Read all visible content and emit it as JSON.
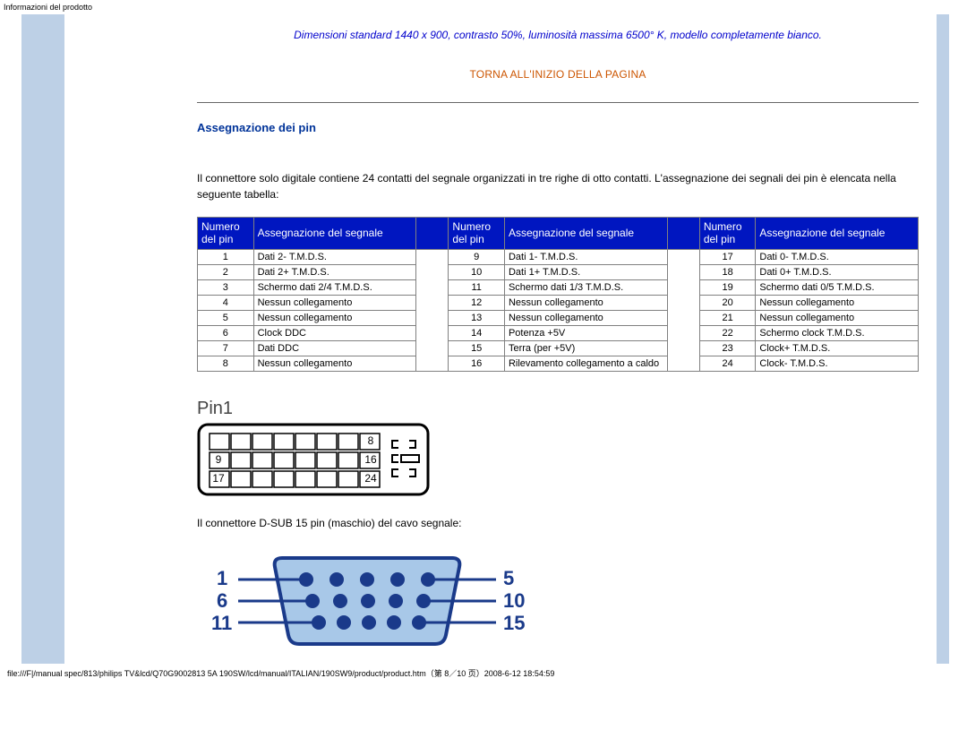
{
  "header": {
    "title": "Informazioni del prodotto"
  },
  "note": "Dimensioni standard 1440 x 900, contrasto 50%, luminosità massima 6500° K, modello completamente bianco.",
  "top_link": "TORNA ALL'INIZIO DELLA PAGINA",
  "section_title": "Assegnazione dei pin",
  "intro": "Il connettore solo digitale contiene 24 contatti del segnale organizzati in tre righe di otto contatti. L'assegnazione dei segnali dei pin è elencata nella seguente tabella:",
  "headers": {
    "num": "Numero del pin",
    "sig": "Assegnazione del segnale"
  },
  "rows": [
    {
      "n1": "1",
      "s1": "Dati 2- T.M.D.S.",
      "n2": "9",
      "s2": "Dati 1- T.M.D.S.",
      "n3": "17",
      "s3": "Dati 0- T.M.D.S."
    },
    {
      "n1": "2",
      "s1": "Dati 2+ T.M.D.S.",
      "n2": "10",
      "s2": "Dati 1+ T.M.D.S.",
      "n3": "18",
      "s3": "Dati 0+ T.M.D.S."
    },
    {
      "n1": "3",
      "s1": "Schermo dati 2/4 T.M.D.S.",
      "n2": "11",
      "s2": "Schermo dati 1/3 T.M.D.S.",
      "n3": "19",
      "s3": "Schermo dati 0/5 T.M.D.S."
    },
    {
      "n1": "4",
      "s1": "Nessun collegamento",
      "n2": "12",
      "s2": "Nessun collegamento",
      "n3": "20",
      "s3": "Nessun collegamento"
    },
    {
      "n1": "5",
      "s1": "Nessun collegamento",
      "n2": "13",
      "s2": "Nessun collegamento",
      "n3": "21",
      "s3": "Nessun collegamento"
    },
    {
      "n1": "6",
      "s1": "Clock DDC",
      "n2": "14",
      "s2": "Potenza +5V",
      "n3": "22",
      "s3": "Schermo clock T.M.D.S."
    },
    {
      "n1": "7",
      "s1": "Dati DDC",
      "n2": "15",
      "s2": "Terra (per +5V)",
      "n3": "23",
      "s3": "Clock+ T.M.D.S."
    },
    {
      "n1": "8",
      "s1": "Nessun collegamento",
      "n2": "16",
      "s2": "Rilevamento collegamento a caldo",
      "n3": "24",
      "s3": "Clock- T.M.D.S."
    }
  ],
  "pin1_label": "Pin1",
  "dvi_numbers": {
    "tr": "8",
    "ml": "9",
    "mr": "16",
    "bl": "17",
    "br": "24"
  },
  "dsub_intro": "Il connettore D-SUB 15 pin (maschio) del cavo segnale:",
  "dsub_labels": {
    "l1": "1",
    "l2": "6",
    "l3": "11",
    "r1": "5",
    "r2": "10",
    "r3": "15"
  },
  "footer": "file:///F|/manual spec/813/philips TV&lcd/Q70G9002813 5A 190SW/lcd/manual/ITALIAN/190SW9/product/product.htm（第 8／10 页）2008-6-12 18:54:59"
}
